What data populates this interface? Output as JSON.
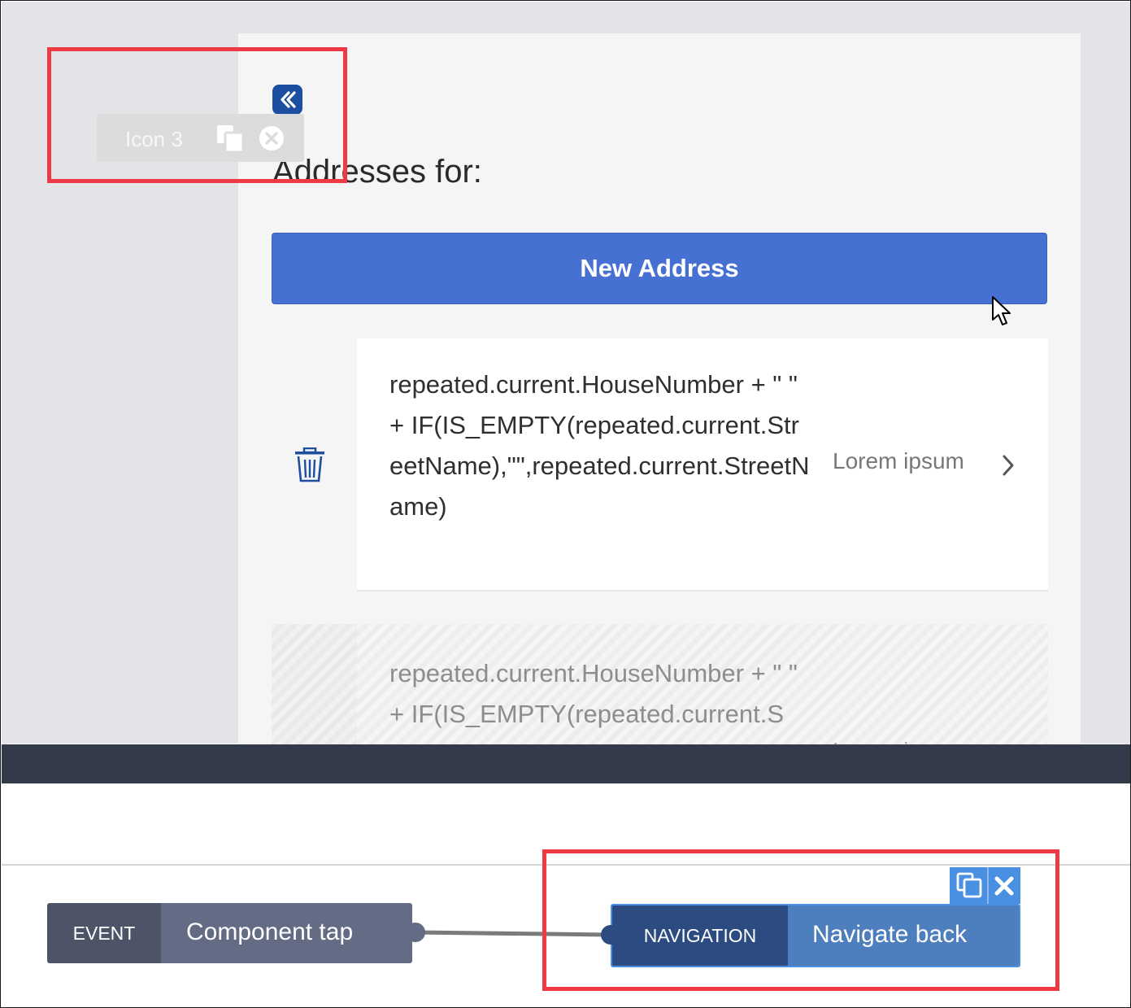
{
  "canvas": {
    "component_label": "Icon 3",
    "page_title": "Addresses for:",
    "new_address_button": "New Address",
    "rows": [
      {
        "text": "repeated.current.HouseNumber + \" \" + IF(IS_EMPTY(repeated.current.StreetName),\"\",repeated.current.StreetName)",
        "meta": "Lorem ipsum"
      },
      {
        "text": "repeated.current.HouseNumber + \" \" + IF(IS_EMPTY(repeated.current.S",
        "meta": "Lorem ipsum"
      }
    ]
  },
  "logic": {
    "event_node": {
      "tag": "EVENT",
      "label": "Component tap"
    },
    "navigation_node": {
      "tag": "NAVIGATION",
      "label": "Navigate back"
    }
  },
  "colors": {
    "primary_button": "#4670d2",
    "highlight_red": "#ee3a44",
    "navigation_dark": "#2c4b80",
    "navigation_light": "#4d7ebd",
    "event_dark": "#4d5467",
    "event_light": "#636b85",
    "divider_bar": "#333a4a"
  },
  "icons": [
    "double-chevron-left-icon",
    "duplicate-icon",
    "close-circle-icon",
    "trash-icon",
    "chevron-right-icon",
    "mouse-cursor-icon",
    "close-icon"
  ]
}
